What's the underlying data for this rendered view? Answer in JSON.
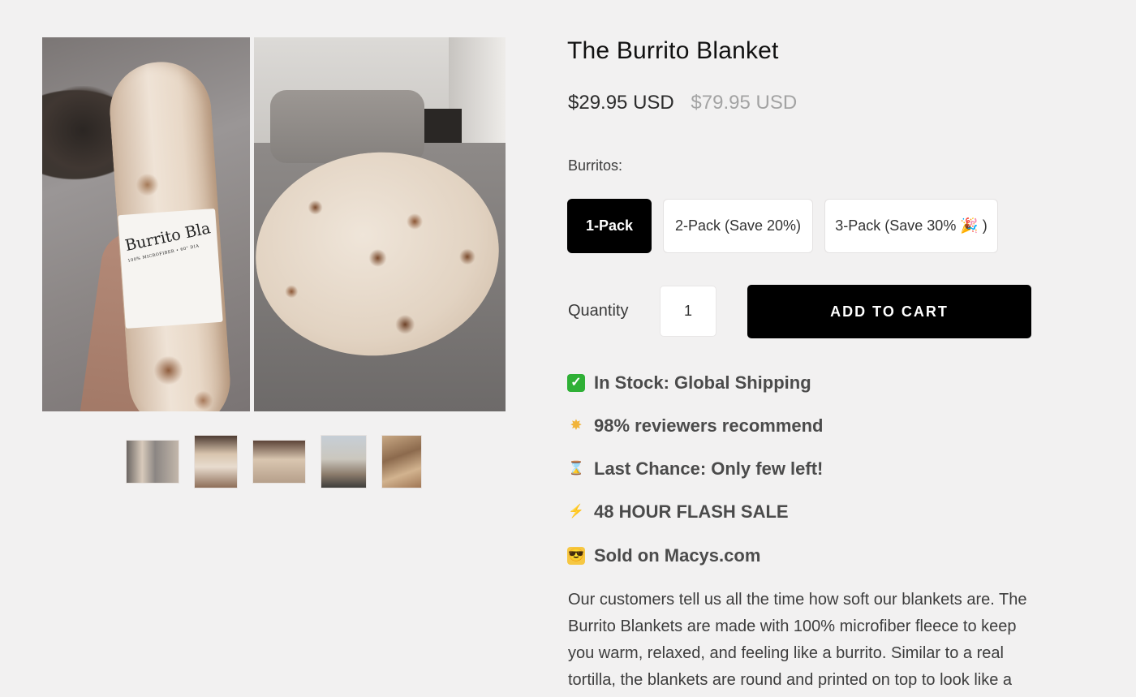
{
  "product": {
    "title": "The Burrito Blanket",
    "price": "$29.95 USD",
    "compare_price": "$79.95 USD"
  },
  "gallery": {
    "label_title": "Burrito Bla",
    "label_subtitle": "100% MICROFIBER • 60\" DIA",
    "thumbnail_count": 5
  },
  "variant": {
    "label": "Burritos:",
    "options": [
      "1-Pack",
      "2-Pack (Save 20%)",
      "3-Pack (Save 30% 🎉 )"
    ],
    "selected": "1-Pack"
  },
  "quantity": {
    "label": "Quantity",
    "value": "1"
  },
  "cart": {
    "button_label": "ADD TO CART"
  },
  "features": [
    {
      "icon": "check-mark-icon",
      "glyph": "✓",
      "text": "In Stock: Global Shipping"
    },
    {
      "icon": "sparkle-icon",
      "glyph": "✸",
      "text": "98% reviewers recommend"
    },
    {
      "icon": "hourglass-icon",
      "glyph": "⌛",
      "text": "Last Chance: Only few left!"
    },
    {
      "icon": "lightning-icon",
      "glyph": "⚡",
      "text": "48 HOUR FLASH SALE"
    },
    {
      "icon": "sunglasses-face-icon",
      "glyph": "😎",
      "text": "Sold on Macys.com"
    }
  ],
  "description": "Our customers tell us all the time how soft our blankets are. The Burrito Blankets are made with 100% microfiber fleece to keep you warm, relaxed, and feeling like a burrito. Similar to a real tortilla, the blankets are round and printed on top to look like a",
  "colors": {
    "background": "#f2f1f1",
    "button": "#000000",
    "compare_price": "#a3a3a3",
    "check": "#2fb036"
  }
}
